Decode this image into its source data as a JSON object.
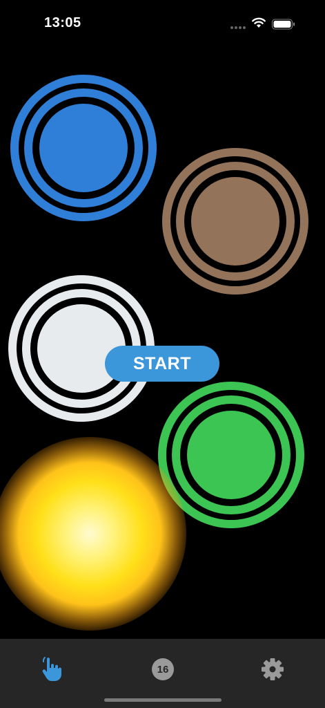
{
  "status_bar": {
    "time": "13:05"
  },
  "game": {
    "start_label": "START",
    "targets": [
      {
        "name": "blue",
        "color": "#2f7fd9"
      },
      {
        "name": "brown",
        "color": "#93735a"
      },
      {
        "name": "white",
        "color": "#e8ebee"
      },
      {
        "name": "green",
        "color": "#3cc552"
      }
    ],
    "glow_color": "#ffe01a"
  },
  "tab_bar": {
    "items": [
      {
        "name": "touch",
        "icon": "hand-pointer-icon",
        "active": true
      },
      {
        "name": "count",
        "badge": "16"
      },
      {
        "name": "settings",
        "icon": "gear-icon"
      }
    ],
    "active_color": "#3b96da",
    "inactive_color": "#9a9a9a"
  }
}
